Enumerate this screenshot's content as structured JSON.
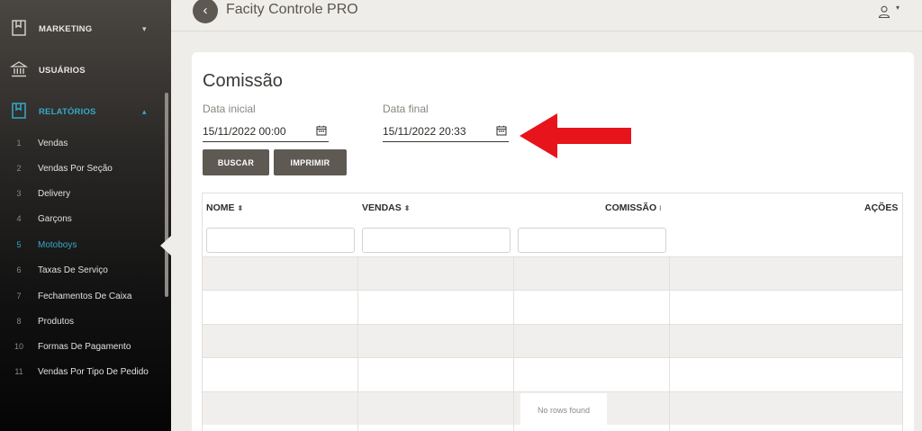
{
  "sidebar": {
    "main_items": [
      {
        "label": "MARKETING",
        "icon": "bookmark-icon",
        "caret": "▾"
      },
      {
        "label": "USUÁRIOS",
        "icon": "bank-icon"
      },
      {
        "label": "RELATÓRIOS",
        "icon": "bookmark-icon",
        "caret": "▴"
      }
    ],
    "sub_items": [
      {
        "num": "1",
        "label": "Vendas"
      },
      {
        "num": "2",
        "label": "Vendas Por Seção"
      },
      {
        "num": "3",
        "label": "Delivery"
      },
      {
        "num": "4",
        "label": "Garçons"
      },
      {
        "num": "5",
        "label": "Motoboys"
      },
      {
        "num": "6",
        "label": "Taxas De Serviço"
      },
      {
        "num": "7",
        "label": "Fechamentos De Caixa"
      },
      {
        "num": "8",
        "label": "Produtos"
      },
      {
        "num": "10",
        "label": "Formas De Pagamento"
      },
      {
        "num": "11",
        "label": "Vendas Por Tipo De Pedido"
      }
    ],
    "active_sub": "Motoboys"
  },
  "header": {
    "back_glyph": "‹",
    "title": "Facity Controle PRO",
    "user_caret": "▾"
  },
  "page": {
    "title": "Comissão",
    "data_inicial_label": "Data inicial",
    "data_inicial_value": "15/11/2022 00:00",
    "data_final_label": "Data final",
    "data_final_value": "15/11/2022 20:33",
    "buscar": "BUSCAR",
    "imprimir": "IMPRIMIR"
  },
  "table": {
    "columns": [
      {
        "label": "NOME",
        "sort": "⬍"
      },
      {
        "label": "VENDAS",
        "sort": "⬍"
      },
      {
        "label": "COMISSÃO",
        "sort": "⁝"
      },
      {
        "label": "AÇÕES"
      }
    ],
    "empty_message": "No rows found"
  },
  "colors": {
    "accent": "#35a9c8",
    "button": "#5f5954",
    "arrow": "#e8141b"
  }
}
